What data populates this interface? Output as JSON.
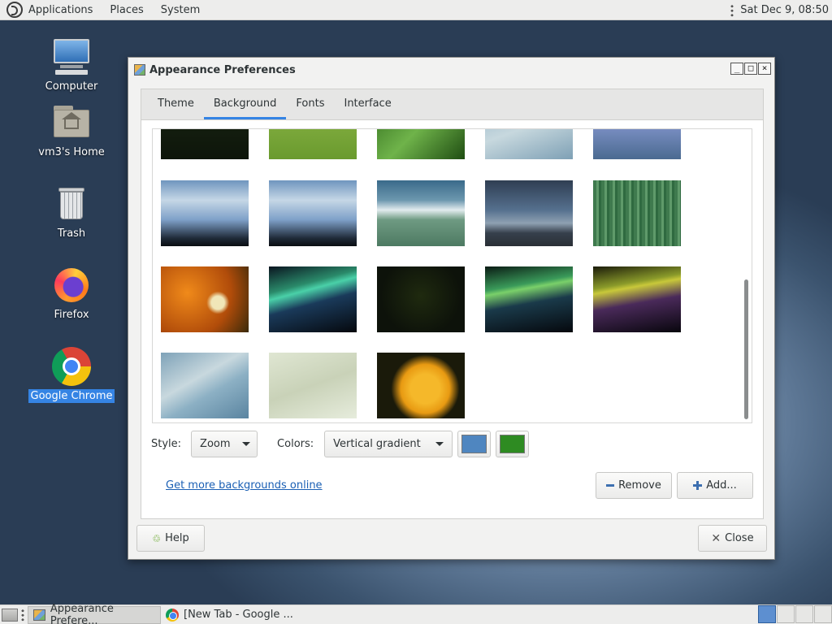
{
  "top_panel": {
    "menus": [
      "Applications",
      "Places",
      "System"
    ],
    "clock": "Sat Dec  9, 08:50"
  },
  "desktop": {
    "icons": [
      {
        "label": "Computer",
        "icon": "computer-icon"
      },
      {
        "label": "vm3's Home",
        "icon": "home-folder-icon"
      },
      {
        "label": "Trash",
        "icon": "trash-icon"
      },
      {
        "label": "Firefox",
        "icon": "firefox-icon"
      },
      {
        "label": "Google Chrome",
        "icon": "chrome-icon",
        "selected": true
      }
    ]
  },
  "window": {
    "title": "Appearance Preferences",
    "controls": [
      "_",
      "□",
      "×"
    ],
    "tabs": [
      {
        "label": "Theme",
        "active": false
      },
      {
        "label": "Background",
        "active": true
      },
      {
        "label": "Fonts",
        "active": false
      },
      {
        "label": "Interface",
        "active": false
      }
    ],
    "background": {
      "style_label": "Style:",
      "style_value": "Zoom",
      "colors_label": "Colors:",
      "colors_value": "Vertical gradient",
      "primary_color": "#4f86c0",
      "secondary_color": "#2e8b22",
      "more_link": "Get more backgrounds online",
      "remove_label": "Remove",
      "add_label": "Add..."
    },
    "help_label": "Help",
    "close_label": "Close"
  },
  "taskbar": {
    "tasks": [
      {
        "label": "Appearance Prefere...",
        "active": true,
        "icon": "appearance-icon"
      },
      {
        "label": "[New Tab - Google ...",
        "active": false,
        "icon": "chrome-icon"
      }
    ],
    "workspace_count": 4,
    "active_workspace": 1
  }
}
